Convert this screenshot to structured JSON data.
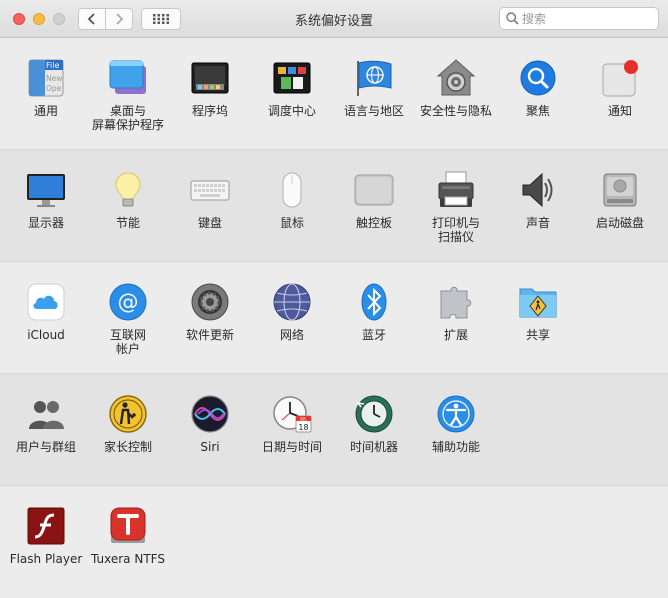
{
  "window": {
    "title": "系统偏好设置",
    "search_placeholder": "搜索"
  },
  "rows": [
    [
      {
        "label": "通用",
        "icon": "general-icon"
      },
      {
        "label": "桌面与",
        "label2": "屏幕保护程序",
        "icon": "desktop-screensaver-icon"
      },
      {
        "label": "程序坞",
        "icon": "dock-icon"
      },
      {
        "label": "调度中心",
        "icon": "mission-control-icon"
      },
      {
        "label": "语言与地区",
        "icon": "language-region-icon"
      },
      {
        "label": "安全性与隐私",
        "icon": "security-privacy-icon"
      },
      {
        "label": "聚焦",
        "icon": "spotlight-icon"
      },
      {
        "label": "通知",
        "icon": "notifications-icon"
      }
    ],
    [
      {
        "label": "显示器",
        "icon": "displays-icon"
      },
      {
        "label": "节能",
        "icon": "energy-saver-icon"
      },
      {
        "label": "键盘",
        "icon": "keyboard-icon"
      },
      {
        "label": "鼠标",
        "icon": "mouse-icon"
      },
      {
        "label": "触控板",
        "icon": "trackpad-icon"
      },
      {
        "label": "打印机与",
        "label2": "扫描仪",
        "icon": "printer-icon"
      },
      {
        "label": "声音",
        "icon": "sound-icon"
      },
      {
        "label": "启动磁盘",
        "icon": "startup-disk-icon"
      }
    ],
    [
      {
        "label": "iCloud",
        "icon": "icloud-icon"
      },
      {
        "label": "互联网",
        "label2": "帐户",
        "icon": "internet-accounts-icon"
      },
      {
        "label": "软件更新",
        "icon": "software-update-icon"
      },
      {
        "label": "网络",
        "icon": "network-icon"
      },
      {
        "label": "蓝牙",
        "icon": "bluetooth-icon"
      },
      {
        "label": "扩展",
        "icon": "extensions-icon"
      },
      {
        "label": "共享",
        "icon": "sharing-icon"
      }
    ],
    [
      {
        "label": "用户与群组",
        "icon": "users-groups-icon"
      },
      {
        "label": "家长控制",
        "icon": "parental-controls-icon"
      },
      {
        "label": "Siri",
        "icon": "siri-icon"
      },
      {
        "label": "日期与时间",
        "icon": "date-time-icon"
      },
      {
        "label": "时间机器",
        "icon": "time-machine-icon"
      },
      {
        "label": "辅助功能",
        "icon": "accessibility-icon"
      }
    ],
    [
      {
        "label": "Flash Player",
        "icon": "flash-player-icon"
      },
      {
        "label": "Tuxera NTFS",
        "icon": "tuxera-ntfs-icon"
      }
    ]
  ],
  "icon_text": {
    "general_file": "File",
    "general_new": "New",
    "general_open": "Ope",
    "calendar_month": "JUL",
    "calendar_day": "18"
  },
  "colors": {
    "accent_blue": "#1e7be2",
    "notification_red": "#e8302a",
    "flash_red": "#8a1414",
    "tuxera_red": "#d8342c"
  }
}
